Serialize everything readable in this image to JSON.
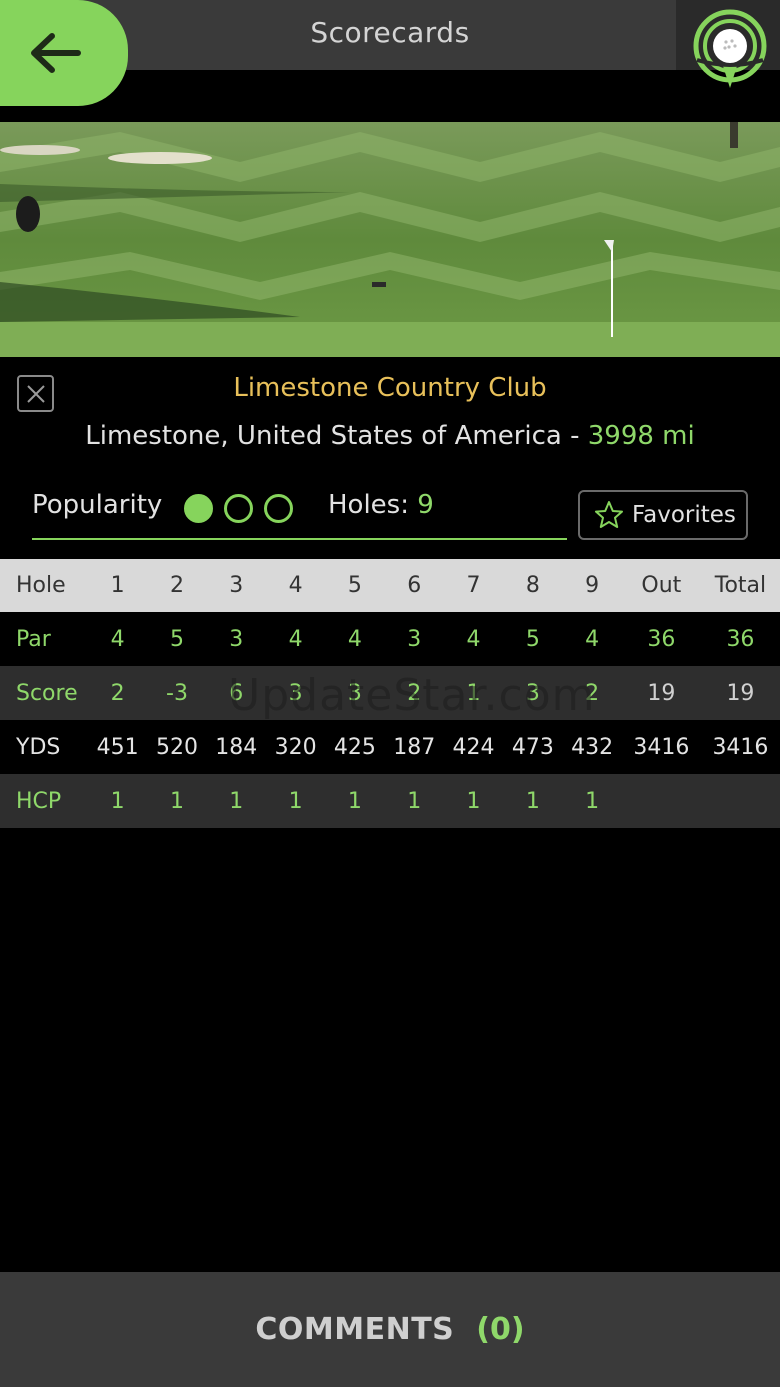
{
  "header": {
    "title": "Scorecards",
    "back_icon": "arrow-left-icon",
    "logo_icon": "golf-ball-signal-icon"
  },
  "course": {
    "name": "Limestone Country Club",
    "location": "Limestone, United States of America - ",
    "distance": "3998 mi",
    "popularity_label": "Popularity",
    "popularity_level": 1,
    "popularity_max": 3,
    "holes_label": "Holes: ",
    "holes_value": "9",
    "favorites_label": "Favorites"
  },
  "scorecard": {
    "header": [
      "Hole",
      "1",
      "2",
      "3",
      "4",
      "5",
      "6",
      "7",
      "8",
      "9",
      "Out",
      "Total"
    ],
    "par": [
      "Par",
      "4",
      "5",
      "3",
      "4",
      "4",
      "3",
      "4",
      "5",
      "4",
      "36",
      "36"
    ],
    "score": [
      "Score",
      "2",
      "-3",
      "6",
      "3",
      "3",
      "2",
      "1",
      "3",
      "2",
      "19",
      "19"
    ],
    "yds": [
      "YDS",
      "451",
      "520",
      "184",
      "320",
      "425",
      "187",
      "424",
      "473",
      "432",
      "3416",
      "3416"
    ],
    "hcp": [
      "HCP",
      "1",
      "1",
      "1",
      "1",
      "1",
      "1",
      "1",
      "1",
      "1",
      "",
      ""
    ]
  },
  "watermark": "UpdateStar.com",
  "footer": {
    "comments_label": "COMMENTS",
    "comments_count": "(0)"
  },
  "colors": {
    "accent": "#86d45c",
    "club_name": "#e8c05a",
    "background": "#000000",
    "bar": "#3a3a3a"
  }
}
